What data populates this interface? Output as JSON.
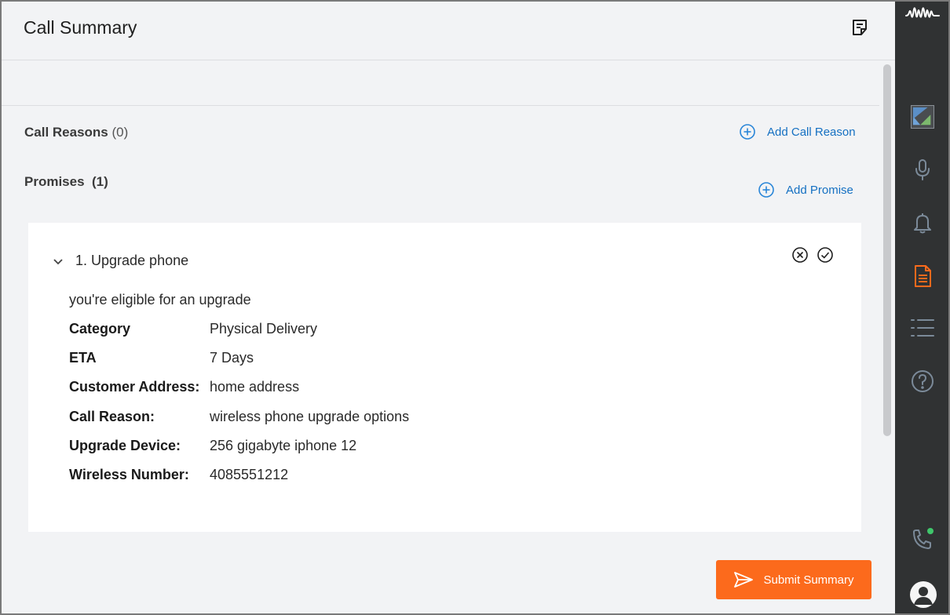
{
  "header": {
    "title": "Call Summary",
    "notes_icon": "notes-icon"
  },
  "call_reasons": {
    "label": "Call Reasons",
    "count": "(0)",
    "add_label": "Add Call Reason"
  },
  "promises": {
    "label": "Promises",
    "count": "(1)",
    "add_label": "Add Promise",
    "items": [
      {
        "title": "1. Upgrade phone",
        "description": "you're eligible for an upgrade",
        "details": [
          {
            "label": "Category",
            "value": "Physical Delivery"
          },
          {
            "label": "ETA",
            "value": "7 Days"
          },
          {
            "label": "Customer Address:",
            "value": "home address"
          },
          {
            "label": "Call Reason:",
            "value": "wireless phone upgrade options"
          },
          {
            "label": "Upgrade Device:",
            "value": "256 gigabyte iphone 12"
          },
          {
            "label": "Wireless Number:",
            "value": "4085551212"
          }
        ]
      }
    ]
  },
  "footer": {
    "submit_label": "Submit Summary"
  },
  "sidebar": {
    "icons": [
      "waveform-logo-icon",
      "image-placeholder-icon",
      "microphone-icon",
      "bell-icon",
      "document-icon",
      "list-icon",
      "help-icon",
      "phone-icon",
      "user-avatar-icon"
    ],
    "active_color": "#fc6a1c"
  },
  "colors": {
    "accent": "#fc6a1c",
    "link": "#1570c2",
    "sidebar_bg": "#303233",
    "status_online": "#3fc66b"
  }
}
